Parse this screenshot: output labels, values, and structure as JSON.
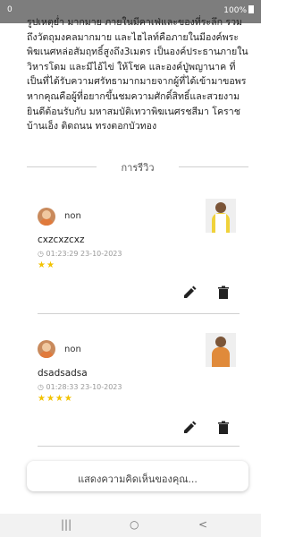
{
  "status_bar": {
    "time": "0",
    "battery": "100%"
  },
  "description": {
    "text": "รูปเหตุย่ำ มากมาย ภายในมีคาเฟ่และของที่ระลึก รวมถึงวัตถุมงคลมากมาย และไฮไลท์คือภายในมีองค์พระพิฆเนศหล่อสัมฤทธิ์สูงถึง3เมตร เป็นองค์ประธานภายในวิหารโดม และมีไอ้ไข่ ให้โชค และองค์ปู่พญานาค ที่เป็นที่ได้รับความศรัทธามากมายจากผู้ที่ได้เข้ามาขอพร หากคุณคือผู้ที่อยากขึ้นชมความศักดิ์สิทธิ์และสวยงาม ยินดีต้อนรับกับ มหาสมบัติเทวาพิฆเนศรชสีมา โคราชบ้านเอ็ง ติดถนน ทรงตอกบัวทอง"
  },
  "reviews": {
    "title": "การรีวิว",
    "items": [
      {
        "name": "non",
        "text": "cxzcxzcxz",
        "date": "◷ 01:23:29 23-10-2023",
        "rating": 2,
        "stars": "★★"
      },
      {
        "name": "non",
        "text": "dsadsadsa",
        "date": "◷ 01:28:33 23-10-2023",
        "rating": 4,
        "stars": "★★★★"
      }
    ]
  },
  "comment": {
    "placeholder": "แสดงความคิดเห็นของคุณ..."
  },
  "nav_bar": {
    "recents": "|||",
    "home": "○",
    "back": "<"
  },
  "colors": {
    "star": "#f2c200",
    "status_bar": "#6f6f6f",
    "nav_bar": "#f2f2f2"
  }
}
